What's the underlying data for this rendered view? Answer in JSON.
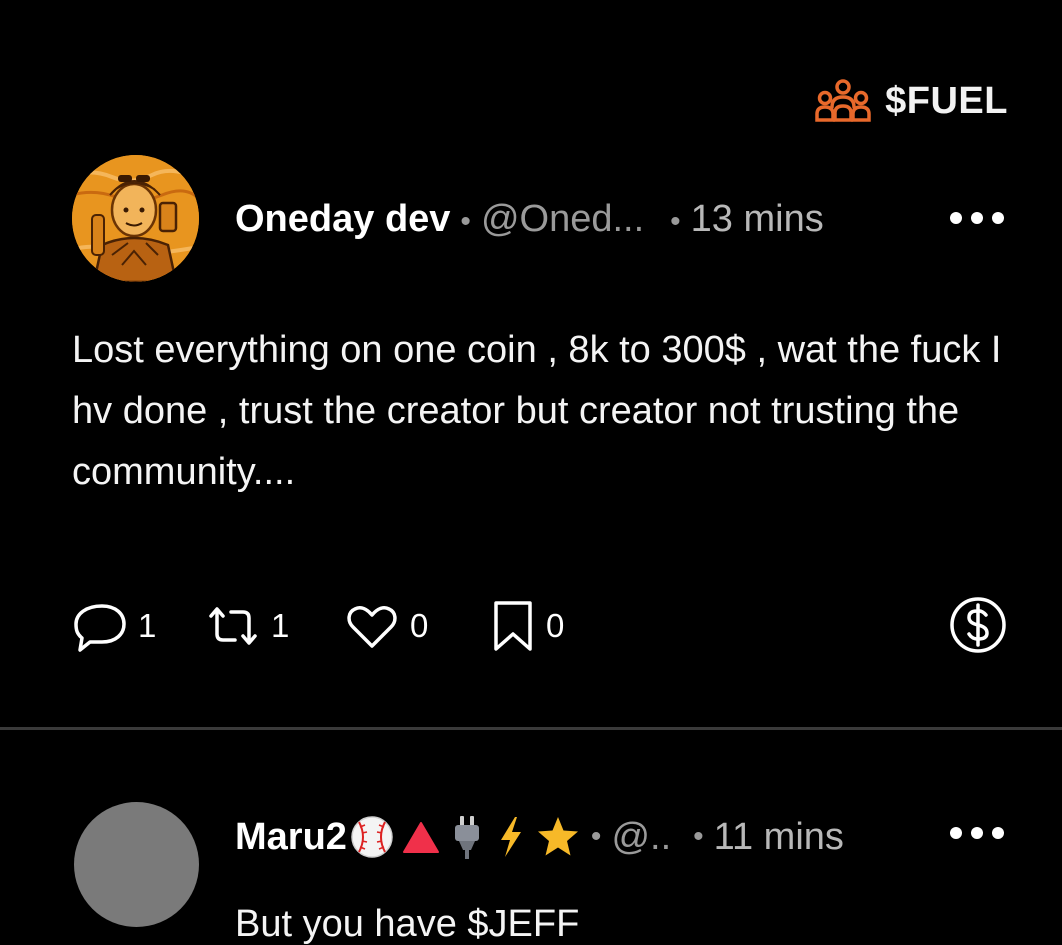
{
  "community": {
    "icon": "people-group-icon",
    "label": "$FUEL",
    "accent": "#e8692b"
  },
  "post": {
    "author_name": "Oneday dev",
    "handle": "@Oned...",
    "time": "13 mins",
    "separator": "•",
    "body": "Lost everything on one coin , 8k to 300$ , wat the fuck I hv done , trust the creator but creator not trusting the community....",
    "actions": {
      "reply_count": "1",
      "repost_count": "1",
      "like_count": "0",
      "bookmark_count": "0"
    },
    "tip_icon": "dollar-circle-icon"
  },
  "reply": {
    "author_name": "Maru2",
    "emojis": [
      "baseball-icon",
      "red-triangle-icon",
      "plug-icon",
      "lightning-icon",
      "star-icon"
    ],
    "handle": "@..",
    "time": "11 mins",
    "separator": "•",
    "body": "But you have $JEFF"
  },
  "colors": {
    "background": "#000000",
    "text": "#ffffff",
    "muted": "#9a9a9a",
    "divider": "#3a3a3a",
    "reply_avatar": "#7a7a7a"
  }
}
